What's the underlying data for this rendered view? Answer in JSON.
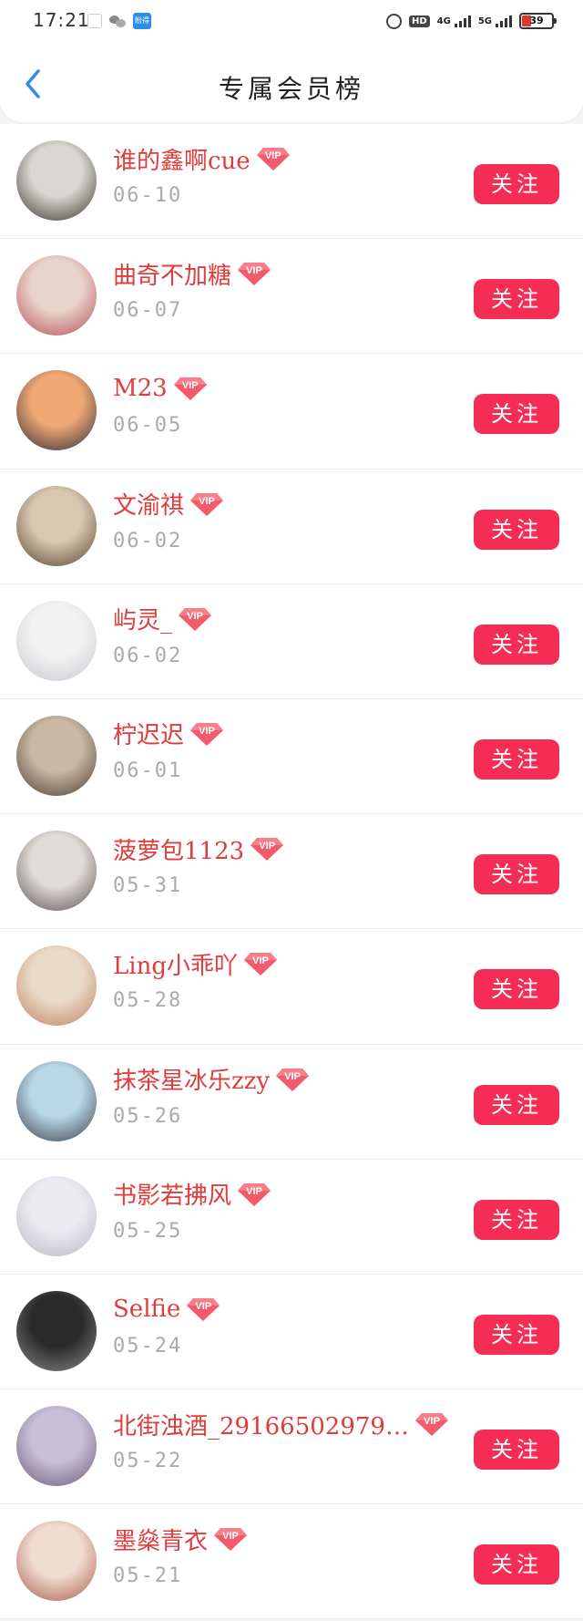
{
  "status_bar": {
    "time": "17:21",
    "network_label": "4G",
    "network_label_2": "5G",
    "hd_label": "HD",
    "battery": "39",
    "app_badge": "盼得"
  },
  "header": {
    "title": "专属会员榜",
    "back_icon": "chevron-left-icon"
  },
  "colors": {
    "accent": "#f52d55",
    "name": "#e03c3c",
    "date": "#aaaaaa",
    "back": "#2e8de6"
  },
  "vip_label": "VIP",
  "follow_label": "关注",
  "members": [
    {
      "name": "谁的鑫啊cue",
      "date": "06-10",
      "avatar_colors": [
        "#d8d8d0",
        "#3a3228"
      ]
    },
    {
      "name": "曲奇不加糖",
      "date": "06-07",
      "avatar_colors": [
        "#e8d4cc",
        "#b84a52"
      ]
    },
    {
      "name": "M23",
      "date": "06-05",
      "avatar_colors": [
        "#f0a874",
        "#2a2a3a"
      ]
    },
    {
      "name": "文渝祺",
      "date": "06-02",
      "avatar_colors": [
        "#d8c8b0",
        "#5a4030"
      ]
    },
    {
      "name": "屿灵_",
      "date": "06-02",
      "avatar_colors": [
        "#f2f2f2",
        "#c8c8d0"
      ]
    },
    {
      "name": "柠迟迟",
      "date": "06-01",
      "avatar_colors": [
        "#c8b8a4",
        "#4a3c30"
      ]
    },
    {
      "name": "菠萝包1123",
      "date": "05-31",
      "avatar_colors": [
        "#e0dcd8",
        "#5a5050"
      ]
    },
    {
      "name": "Ling小乖吖",
      "date": "05-28",
      "avatar_colors": [
        "#e8dcc8",
        "#c08060"
      ]
    },
    {
      "name": "抹茶星冰乐zzy",
      "date": "05-26",
      "avatar_colors": [
        "#b8d8e8",
        "#3a3a44"
      ]
    },
    {
      "name": "书影若拂风",
      "date": "05-25",
      "avatar_colors": [
        "#ecebf0",
        "#b8b4c4"
      ]
    },
    {
      "name": "Selfie",
      "date": "05-24",
      "avatar_colors": [
        "#2a2a2a",
        "#8a8a8a"
      ]
    },
    {
      "name": "北街浊酒_29166502979…",
      "date": "05-22",
      "avatar_colors": [
        "#c8c0d8",
        "#6a5a78"
      ]
    },
    {
      "name": "墨燊青衣",
      "date": "05-21",
      "avatar_colors": [
        "#f0dcd0",
        "#a85a4a"
      ]
    }
  ]
}
